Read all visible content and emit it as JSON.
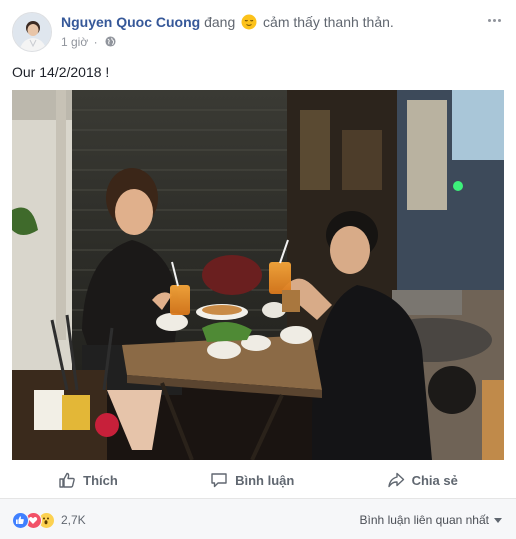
{
  "post": {
    "author_name": "Nguyen Quoc Cuong",
    "activity_prefix": "đang",
    "feeling_emoji": "relieved-face-icon",
    "feeling_text": "cảm thấy thanh thản.",
    "timestamp": "1 giờ",
    "separator": "·",
    "privacy_icon": "globe-icon",
    "text": "Our 14/2/2018 !"
  },
  "actions": {
    "like_label": "Thích",
    "comment_label": "Bình luận",
    "share_label": "Chia sẻ"
  },
  "stats": {
    "reactions": [
      "like",
      "love",
      "wow"
    ],
    "reaction_count": "2,7K",
    "sort_label": "Bình luận liên quan nhất"
  },
  "colors": {
    "link": "#365899",
    "like": "#4080ff",
    "love": "#f25268",
    "wow": "#fcd150",
    "muted": "#90949c"
  }
}
